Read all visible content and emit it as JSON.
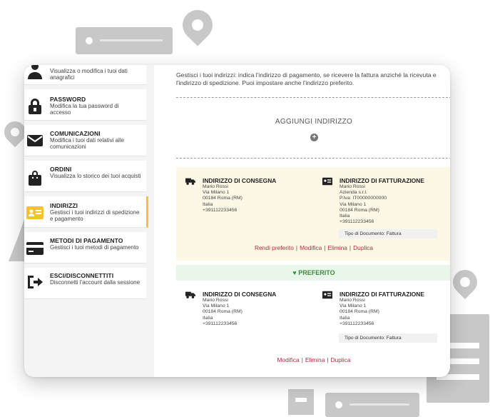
{
  "sidebar": {
    "items": [
      {
        "title": "",
        "desc": "Visualizza o modifica i tuoi dati anagrafici",
        "icon": "user-icon"
      },
      {
        "title": "PASSWORD",
        "desc": "Modifica la tua password di accesso",
        "icon": "lock-icon"
      },
      {
        "title": "COMUNICAZIONI",
        "desc": "Modifica i tuoi dati relativi alle comunicazioni",
        "icon": "envelope-icon"
      },
      {
        "title": "ORDINI",
        "desc": "Visualizza lo storico dei tuoi acquisti",
        "icon": "shopping-bag-icon"
      },
      {
        "title": "INDIRIZZI",
        "desc": "Gestisci i tuoi indirizzi di spedizione e pagamento",
        "icon": "id-card-icon"
      },
      {
        "title": "METODI DI PAGAMENTO",
        "desc": "Gestisci i tuoi metodi di pagamento",
        "icon": "credit-card-icon"
      },
      {
        "title": "ESCI/DISCONNETTITI",
        "desc": "Disconnetti l'account dalla sessione",
        "icon": "logout-icon"
      }
    ]
  },
  "main": {
    "intro": "Gestisci i tuoi indirizzi: indica l'indirizzo di pagamento, se ricevere la fattura anziché la ricevuta e l'indirizzo di spedizione. Puoi impostare anche l'indirizzo preferito.",
    "add_label": "AGGIUNGI INDIRIZZO"
  },
  "address1": {
    "shipping": {
      "title": "INDIRIZZO DI CONSEGNA",
      "lines": [
        "Mario Rossi",
        "Via Milano 1",
        "00184 Roma (RM)",
        "Italia",
        "+391112233456"
      ]
    },
    "billing": {
      "title": "INDIRIZZO DI FATTURAZIONE",
      "lines": [
        "Mario Rossi",
        "Azienda s.r.l.",
        "P.Iva: IT00000000000",
        "Via Milano 1",
        "00184 Roma (RM)",
        "Italia",
        "+391112233456"
      ],
      "doc_type": "Tipo di Documento: Fattura"
    },
    "actions": [
      "Rendi preferito",
      "Modifica",
      "Elimina",
      "Duplica"
    ]
  },
  "address2": {
    "badge": "PREFERITO",
    "shipping": {
      "title": "INDIRIZZO DI CONSEGNA",
      "lines": [
        "Mario Rossi",
        "Via Milano 1",
        "00184 Roma (RM)",
        "Italia",
        "+391112233456"
      ]
    },
    "billing": {
      "title": "INDIRIZZO DI FATTURAZIONE",
      "lines": [
        "Mario Rossi",
        "Via Milano 1",
        "00184 Roma (RM)",
        "Italia",
        "+391112233456"
      ],
      "doc_type": "Tipo di Documento: Fattura"
    },
    "actions": [
      "Modifica",
      "Elimina",
      "Duplica"
    ]
  },
  "colors": {
    "accent": "#f4c430",
    "action_link": "#b32a47",
    "preferred_bg": "#e9f6ea",
    "preferred_text": "#3b8a41",
    "selected_bg": "#fdf8e6"
  }
}
